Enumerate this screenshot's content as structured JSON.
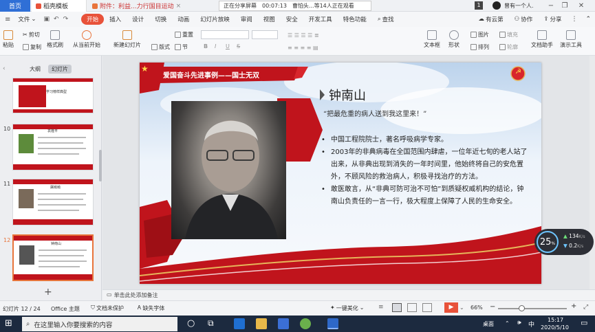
{
  "titlebar": {
    "home_tab": "首页",
    "tab1": "稻壳模板",
    "tab2": "附件：利益...力行国目运动",
    "share_status": "正在分享屏幕",
    "timer": "00:07:13",
    "viewers": "曹怕头...等14人正在观看",
    "badge": "1",
    "user": "曾有一个人."
  },
  "menubar": {
    "file": "文件",
    "items": [
      "开始",
      "插入",
      "设计",
      "切换",
      "动画",
      "幻灯片放映",
      "审阅",
      "视图",
      "安全",
      "开发工具",
      "特色功能"
    ],
    "search": "查找",
    "cloud": "有云第",
    "collab": "协作",
    "share": "分享"
  },
  "ribbon": {
    "paste": "粘贴",
    "cut": "剪切",
    "copy": "复制",
    "format_painter": "格式刷",
    "play_from_current": "从当前开始",
    "new_slide": "新建幻灯片",
    "layout": "版式",
    "section": "节",
    "reset": "重置",
    "bold": "B",
    "italic": "I",
    "underline": "U",
    "strike": "S",
    "textbox": "文本框",
    "shape": "形状",
    "arrange": "排列",
    "image": "图片",
    "fill": "填充",
    "outline": "轮廓",
    "doc_assistant": "文档助手",
    "presentation_tools": "演示工具"
  },
  "leftpanel": {
    "tab_outline": "大纲",
    "tab_slides": "幻灯片",
    "thumbs": [
      {
        "num": "",
        "title": "学习榜样典型"
      },
      {
        "num": "10",
        "title": "袁隆平"
      },
      {
        "num": "11",
        "title": "屠呦呦"
      },
      {
        "num": "12",
        "title": "钟南山"
      }
    ],
    "add": "+"
  },
  "slide": {
    "header": "爱国奋斗先进事例——国士无双",
    "name": "钟南山",
    "quote": "“把最危重的病人送到我这里来！”",
    "bullets": [
      "中国工程院院士，著名呼吸病学专家。",
      "2003年的非典病毒在全国范围内肆虐，一位年近七旬的老人站了出来，从非典出现到消失的一年时间里，他始终将自己的安危置外，不顾风险的救治病人，积极寻找治疗的方法。",
      "敢医敢言，从“非典可防可治不可怕”到质疑权威机构的结论，钟南山负责任的一言一行，极大程度上保障了人民的生命安全。"
    ]
  },
  "notes": {
    "placeholder": "单击此处添加备注"
  },
  "speed": {
    "percent": "25",
    "pct_sign": "%",
    "up": "134",
    "down": "0.2",
    "unit": "K/s"
  },
  "statusbar": {
    "slide_pos": "幻灯片 12 / 24",
    "theme": "Office 主题",
    "backup": "文档未保护",
    "font": "缺失字体",
    "beautify": "一键美化",
    "zoom": "66%",
    "zoom_minus": "−",
    "zoom_plus": "+"
  },
  "taskbar": {
    "search_placeholder": "在这里输入你要搜索的内容",
    "time": "15:17",
    "date": "2020/5/10",
    "ime": "中",
    "tray_text": "桌面"
  },
  "colors": {
    "accent": "#e8523a",
    "red": "#c0141c",
    "blue": "#2f6fd6"
  }
}
